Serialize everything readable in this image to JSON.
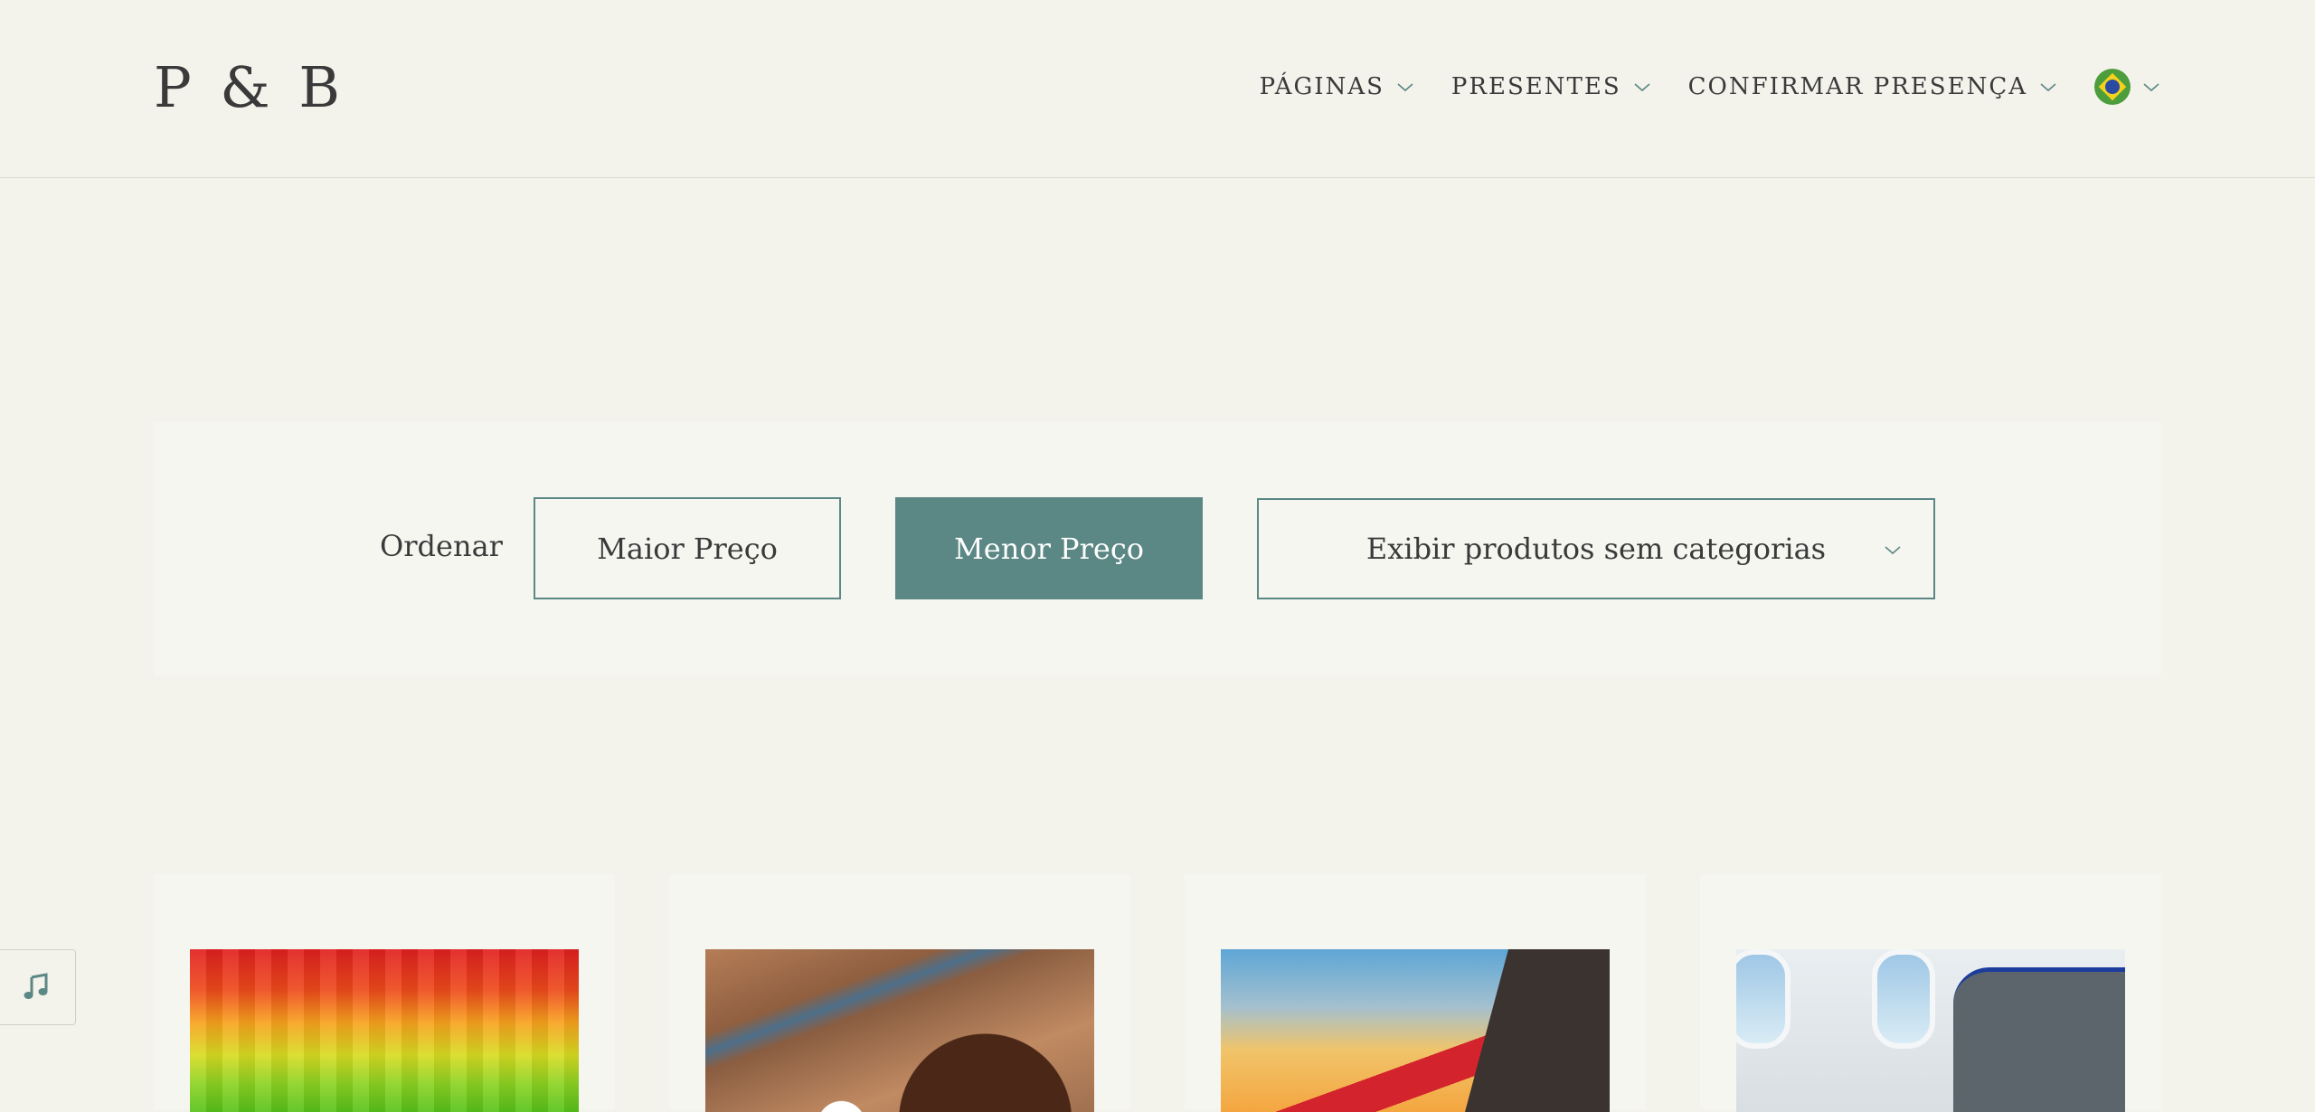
{
  "header": {
    "logo": "P & B",
    "nav": [
      {
        "label": "PÁGINAS"
      },
      {
        "label": "PRESENTES"
      },
      {
        "label": "CONFIRMAR PRESENÇA"
      }
    ],
    "language_icon": "brazil-flag-icon"
  },
  "filters": {
    "sort_label": "Ordenar",
    "highest_price": "Maior Preço",
    "lowest_price": "Menor Preço",
    "category_select": "Exibir produtos sem categorias"
  },
  "products": [
    {
      "image": "rainbow-pixel-image"
    },
    {
      "image": "chocolate-truffle-image"
    },
    {
      "image": "red-train-image"
    },
    {
      "image": "airplane-cabin-image"
    }
  ],
  "music_icon": "music-note-icon",
  "colors": {
    "background": "#f3f3ec",
    "accent": "#5b8784",
    "panel": "#f6f6f1"
  }
}
